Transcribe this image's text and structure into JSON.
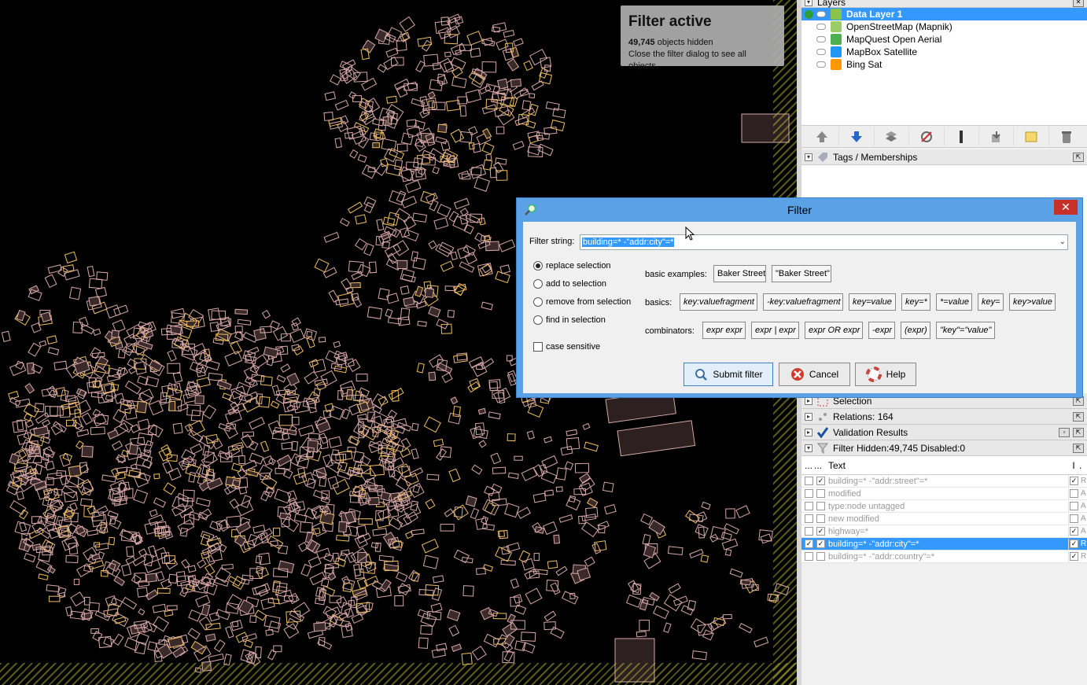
{
  "map": {
    "filter_active": {
      "title": "Filter active",
      "hidden_count": "49,745",
      "hidden_text": "objects hidden",
      "hint": "Close the filter dialog to see all objects."
    }
  },
  "layers": {
    "title": "Layers",
    "items": [
      {
        "label": "Data Layer 1",
        "selected": true,
        "icon_color": "#8bc34a"
      },
      {
        "label": "OpenStreetMap (Mapnik)",
        "selected": false,
        "icon_color": "#9ccc65"
      },
      {
        "label": "MapQuest Open Aerial",
        "selected": false,
        "icon_color": "#4caf50"
      },
      {
        "label": "MapBox Satellite",
        "selected": false,
        "icon_color": "#2196f3"
      },
      {
        "label": "Bing Sat",
        "selected": false,
        "icon_color": "#ff9800"
      }
    ]
  },
  "tags": {
    "title": "Tags / Memberships"
  },
  "selection": {
    "title": "Selection"
  },
  "relations": {
    "title": "Relations: 164"
  },
  "validation": {
    "title": "Validation Results"
  },
  "filter_panel": {
    "title": "Filter Hidden:49,745 Disabled:0",
    "col_text": "Text",
    "col_e": "...",
    "col_h": "...",
    "col_i": "I",
    "col_m": ".",
    "rows": [
      {
        "text": "building=* -\"addr:street\"=*",
        "enabled": false,
        "hiding": true,
        "inverted": true,
        "mode": "R",
        "selected": false
      },
      {
        "text": "modified",
        "enabled": false,
        "hiding": false,
        "inverted": false,
        "mode": "A",
        "selected": false
      },
      {
        "text": "type:node untagged",
        "enabled": false,
        "hiding": false,
        "inverted": false,
        "mode": "A",
        "selected": false
      },
      {
        "text": "new modified",
        "enabled": false,
        "hiding": false,
        "inverted": false,
        "mode": "A",
        "selected": false
      },
      {
        "text": "highway=*",
        "enabled": false,
        "hiding": true,
        "inverted": true,
        "mode": "A",
        "selected": false
      },
      {
        "text": "building=* -\"addr:city\"=*",
        "enabled": true,
        "hiding": true,
        "inverted": true,
        "mode": "R",
        "selected": true
      },
      {
        "text": "building=* -\"addr:country\"=*",
        "enabled": false,
        "hiding": false,
        "inverted": true,
        "mode": "R",
        "selected": false
      }
    ]
  },
  "filter_dialog": {
    "title": "Filter",
    "filter_string_label": "Filter string:",
    "filter_string_value": "building=* -\"addr:city\"=*",
    "radios": [
      {
        "label": "replace selection",
        "checked": true
      },
      {
        "label": "add to selection",
        "checked": false
      },
      {
        "label": "remove from selection",
        "checked": false
      },
      {
        "label": "find in selection",
        "checked": false
      }
    ],
    "case_sensitive_label": "case sensitive",
    "basic_examples_label": "basic examples:",
    "basic_examples": [
      "Baker Street",
      "\"Baker Street\""
    ],
    "basics_label": "basics:",
    "basics": [
      "key:valuefragment",
      "-key:valuefragment",
      "key=value",
      "key=*",
      "*=value",
      "key=",
      "key>value"
    ],
    "combinators_label": "combinators:",
    "combinators": [
      "expr expr",
      "expr | expr",
      "expr OR expr",
      "-expr",
      "(expr)",
      "\"key\"=\"value\""
    ],
    "submit_label": "Submit filter",
    "cancel_label": "Cancel",
    "help_label": "Help"
  }
}
